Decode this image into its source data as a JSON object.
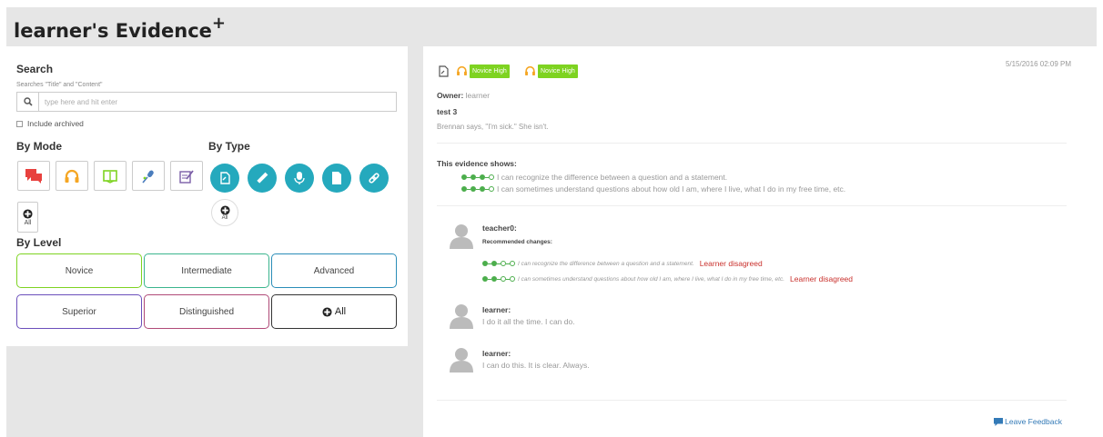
{
  "app": {
    "title": "learner's Evidence",
    "title_plus": "+"
  },
  "search": {
    "heading": "Search",
    "hint": "Searches \"Title\" and \"Content\"",
    "placeholder": "type here and hit enter",
    "include_archived": "Include archived"
  },
  "filters": {
    "by_mode": "By Mode",
    "by_type": "By Type",
    "by_level": "By Level",
    "all_label": "All",
    "modes": [
      {
        "icon": "speech-bubbles-icon",
        "color": "#e8413e"
      },
      {
        "icon": "headphones-icon",
        "color": "#f5a623"
      },
      {
        "icon": "open-book-icon",
        "color": "#7ed321"
      },
      {
        "icon": "microphone-pen-icon",
        "color": "#4a7dbd"
      },
      {
        "icon": "writing-icon",
        "color": "#7b5ea7"
      }
    ],
    "types": [
      {
        "icon": "document-icon"
      },
      {
        "icon": "pencil-icon"
      },
      {
        "icon": "microphone-icon"
      },
      {
        "icon": "file-icon"
      },
      {
        "icon": "link-icon"
      }
    ],
    "levels": [
      {
        "label": "Novice",
        "color": "#7ed321"
      },
      {
        "label": "Intermediate",
        "color": "#3bb58e"
      },
      {
        "label": "Advanced",
        "color": "#2a8db8"
      },
      {
        "label": "Superior",
        "color": "#6b4fbb"
      },
      {
        "label": "Distinguished",
        "color": "#b04a78"
      },
      {
        "label": "All",
        "color": "#333333"
      }
    ]
  },
  "evidence": {
    "timestamp": "5/15/2016 02:09 PM",
    "badges": [
      "Novice High",
      "Novice High"
    ],
    "owner_label": "Owner:",
    "owner": "learner",
    "title": "test 3",
    "description": "Brennan says, \"I'm sick.\" She isn't.",
    "shows_label": "This evidence shows:",
    "can_dos": [
      "I can recognize the difference between a question and a statement.",
      "I can sometimes understand questions about how old I am, where I live, what I do in my free time, etc."
    ]
  },
  "comments": [
    {
      "author": "teacher0:",
      "recommended_label": "Recommended changes:",
      "changes": [
        {
          "text": "I can recognize the difference between a question and a statement.",
          "status": "Learner disagreed"
        },
        {
          "text": "I can sometimes understand questions about how old I am, where I live, what I do in my free time, etc.",
          "status": "Learner disagreed"
        }
      ]
    },
    {
      "author": "learner:",
      "text": "I do it all the time. I can do."
    },
    {
      "author": "learner:",
      "text": "I can do this. It is clear. Always."
    }
  ],
  "footer": {
    "feedback": "Leave Feedback"
  },
  "colors": {
    "type_accent": "#25a9bd",
    "badge": "#7ed321",
    "dot": "#4cae4c",
    "disagree": "#c9302c",
    "link": "#337ab7"
  }
}
